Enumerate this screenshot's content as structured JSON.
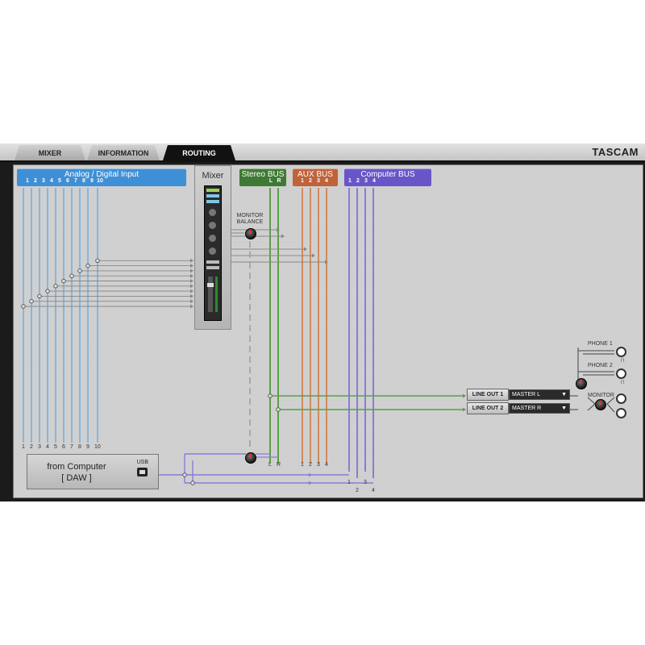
{
  "tabs": [
    {
      "label": "MIXER",
      "active": false
    },
    {
      "label": "INFORMATION",
      "active": false
    },
    {
      "label": "ROUTING",
      "active": true
    }
  ],
  "brand": "TASCAM",
  "buses": {
    "analog": {
      "title": "Analog / Digital Input",
      "nums": [
        "1",
        "2",
        "3",
        "4",
        "5",
        "6",
        "7",
        "8",
        "9",
        "10"
      ],
      "color": "#3f8fd6"
    },
    "mixer": {
      "title": "Mixer"
    },
    "stereo": {
      "title": "Stereo BUS",
      "nums": [
        "L",
        "R"
      ],
      "color": "#3f7a35"
    },
    "aux": {
      "title": "AUX BUS",
      "nums": [
        "1",
        "2",
        "3",
        "4"
      ],
      "color": "#c0623a"
    },
    "computer": {
      "title": "Computer BUS",
      "nums": [
        "1",
        "2",
        "3",
        "4"
      ],
      "color": "#6a55c8"
    }
  },
  "monitor_balance": {
    "line1": "MONITOR",
    "line2": "BALANCE"
  },
  "bottom_labels": {
    "analog": [
      "1",
      "2",
      "3",
      "4",
      "5",
      "6",
      "7",
      "8",
      "9",
      "10"
    ],
    "stereo": [
      "L",
      "R"
    ],
    "aux": [
      "1",
      "2",
      "3",
      "4"
    ],
    "computer_top": [
      "1",
      "3"
    ],
    "computer_bottom": [
      "2",
      "4"
    ]
  },
  "daw": {
    "line1": "from Computer",
    "line2": "[ DAW ]",
    "usb": "USB"
  },
  "line_outs": [
    {
      "label": "LINE OUT 1",
      "value": "MASTER L"
    },
    {
      "label": "LINE OUT 2",
      "value": "MASTER R"
    }
  ],
  "phones": [
    "PHONE 1",
    "PHONE 2"
  ],
  "monitor": "MONITOR",
  "colors": {
    "analog": "#86b6dd",
    "stereo": "#5aa04a",
    "aux": "#d08b5c",
    "computer": "#8a7bdc"
  }
}
